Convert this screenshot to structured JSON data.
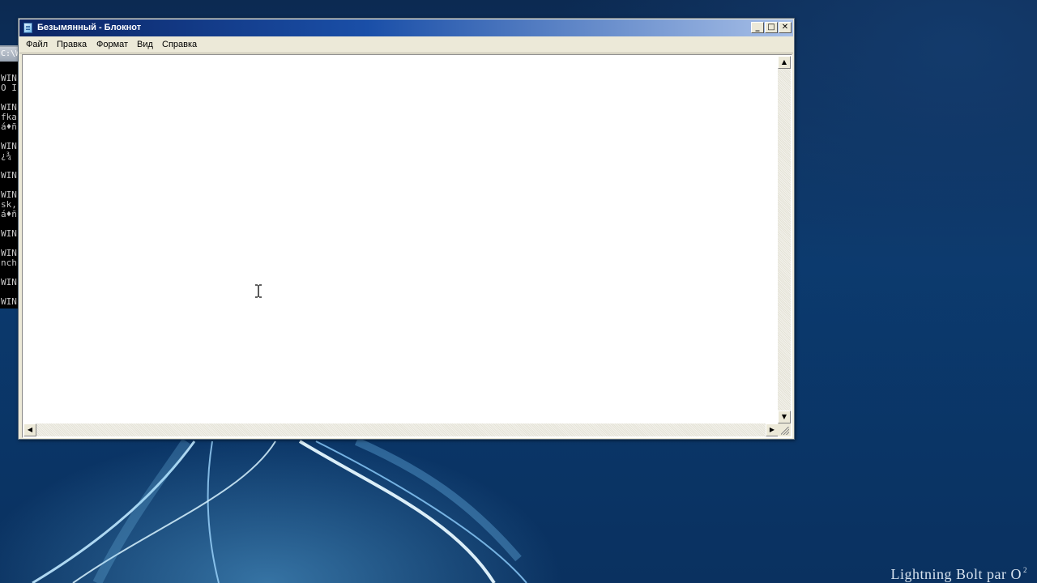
{
  "desktop": {
    "watermark": "Lightning Bolt par O",
    "watermark_sup": "2"
  },
  "console": {
    "title": "C:\\W",
    "lines": [
      "WIN",
      "O I",
      "WIN",
      "fka",
      "á♦ñ",
      "WIN",
      "¿¾",
      "WIN",
      "WIN",
      "sk,",
      "á♦ñ",
      "WIN",
      "WIN",
      "nch",
      "WIN",
      "WIN"
    ]
  },
  "notepad": {
    "title": "Безымянный - Блокнот",
    "menu": [
      "Файл",
      "Правка",
      "Формат",
      "Вид",
      "Справка"
    ],
    "content": ""
  },
  "colors": {
    "titlebar_start": "#0b2463",
    "titlebar_end": "#a8c0e8",
    "window_face": "#ece9d8"
  }
}
